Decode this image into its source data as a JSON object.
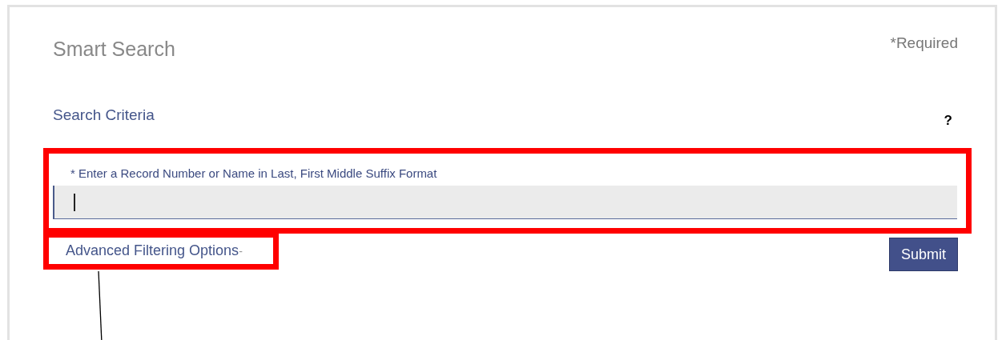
{
  "title": "Smart Search",
  "required_note": "*Required",
  "section": {
    "heading": "Search Criteria",
    "help": "?"
  },
  "search_field": {
    "label": "* Enter a Record Number or Name in Last, First Middle Suffix Format",
    "focused": true
  },
  "advanced_link": {
    "label": "Advanced Filtering Options",
    "toggle": "-"
  },
  "submit_button": "Submit"
}
